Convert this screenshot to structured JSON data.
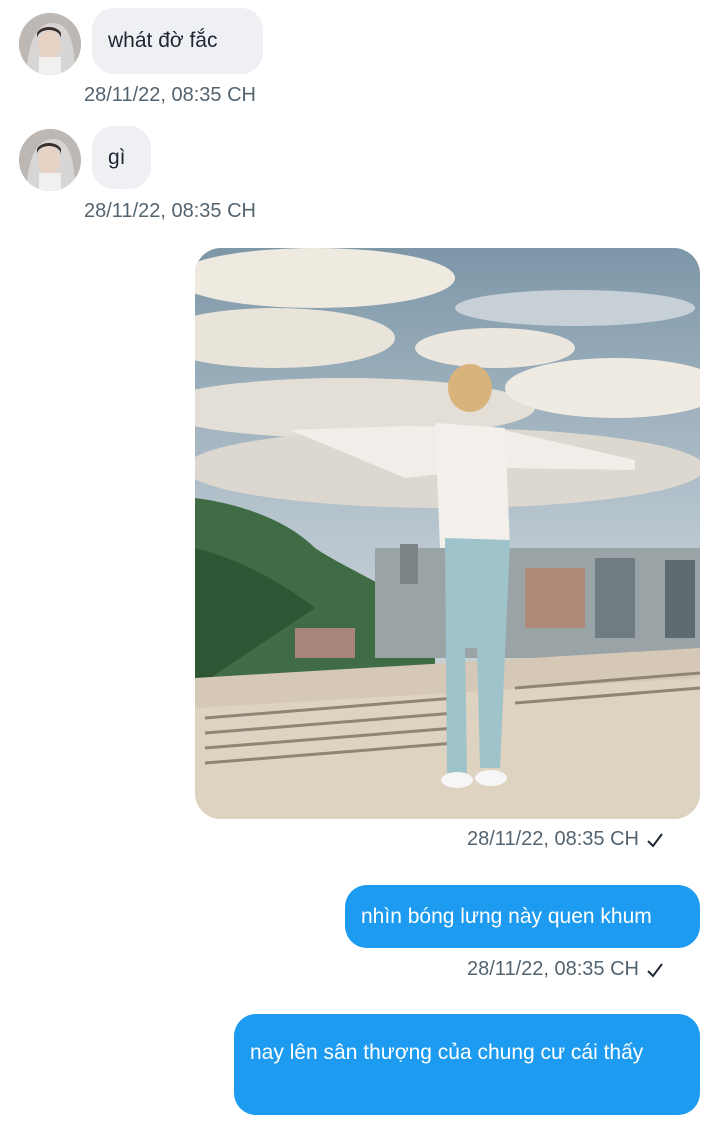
{
  "messages": [
    {
      "text": "whát đờ fắc",
      "timestamp": "28/11/22,  08:35 CH"
    },
    {
      "text": "gì",
      "timestamp": "28/11/22,  08:35 CH"
    },
    {
      "timestamp": "28/11/22,  08:35 CH"
    },
    {
      "text": "nhìn bóng lưng này quen khum",
      "timestamp": "28/11/22,  08:35 CH"
    },
    {
      "text": "nay lên sân thượng của chung cư cái thấy"
    }
  ],
  "colors": {
    "sent_bubble": "#1d9bf0",
    "received_bubble": "#eef0f3",
    "timestamp": "#536471"
  }
}
